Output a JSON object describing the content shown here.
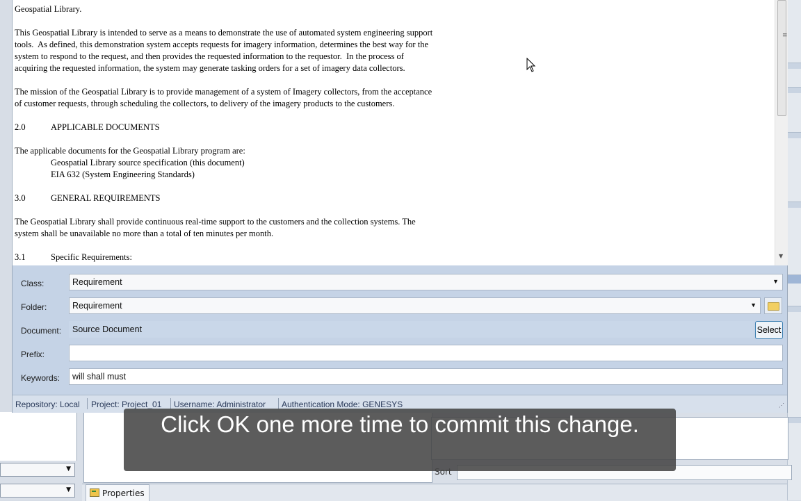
{
  "document_text": {
    "line_intro": "Geospatial Library.",
    "para1": [
      "This Geospatial Library is intended to serve as a means to demonstrate the use of automated system engineering support",
      "tools.  As defined, this demonstration system accepts requests for imagery information, determines the best way for the",
      "system to respond to the request, and then provides the requested information to the requestor.  In the process of",
      "acquiring the requested information, the system may generate tasking orders for a set of imagery data collectors."
    ],
    "para2": [
      "The mission of the Geospatial Library is to provide management of a system of Imagery collectors, from the acceptance",
      "of customer requests, through scheduling the collectors, to delivery of the imagery products to the customers."
    ],
    "section2_num": "2.0",
    "section2_title": "APPLICABLE DOCUMENTS",
    "para3": "The applicable documents for the Geospatial Library program are:",
    "doc_list": [
      "Geospatial Library source specification (this document)",
      "EIA 632 (System Engineering Standards)"
    ],
    "section3_num": "3.0",
    "section3_title": "GENERAL REQUIREMENTS",
    "para4": [
      "The Geospatial Library shall provide continuous real-time support to the customers and the collection systems. The",
      "system shall be unavailable no more than a total of ten minutes per month."
    ],
    "section31_num": "3.1",
    "section31_title": "Specific Requirements:"
  },
  "form": {
    "class_label": "Class:",
    "class_value": "Requirement",
    "folder_label": "Folder:",
    "folder_value": "Requirement",
    "document_label": "Document:",
    "document_value": "Source Document",
    "select_label": "Select",
    "prefix_label": "Prefix:",
    "prefix_value": "",
    "keywords_label": "Keywords:",
    "keywords_value": "will shall must"
  },
  "status_bar": {
    "repository": "Repository: Local",
    "project": "Project: Project_01",
    "username": "Username: Administrator",
    "auth": "Authentication Mode: GENESYS"
  },
  "background": {
    "sort_label": "Sort",
    "properties_tab": "Properties"
  },
  "caption": "Click OK one more time to commit this change."
}
